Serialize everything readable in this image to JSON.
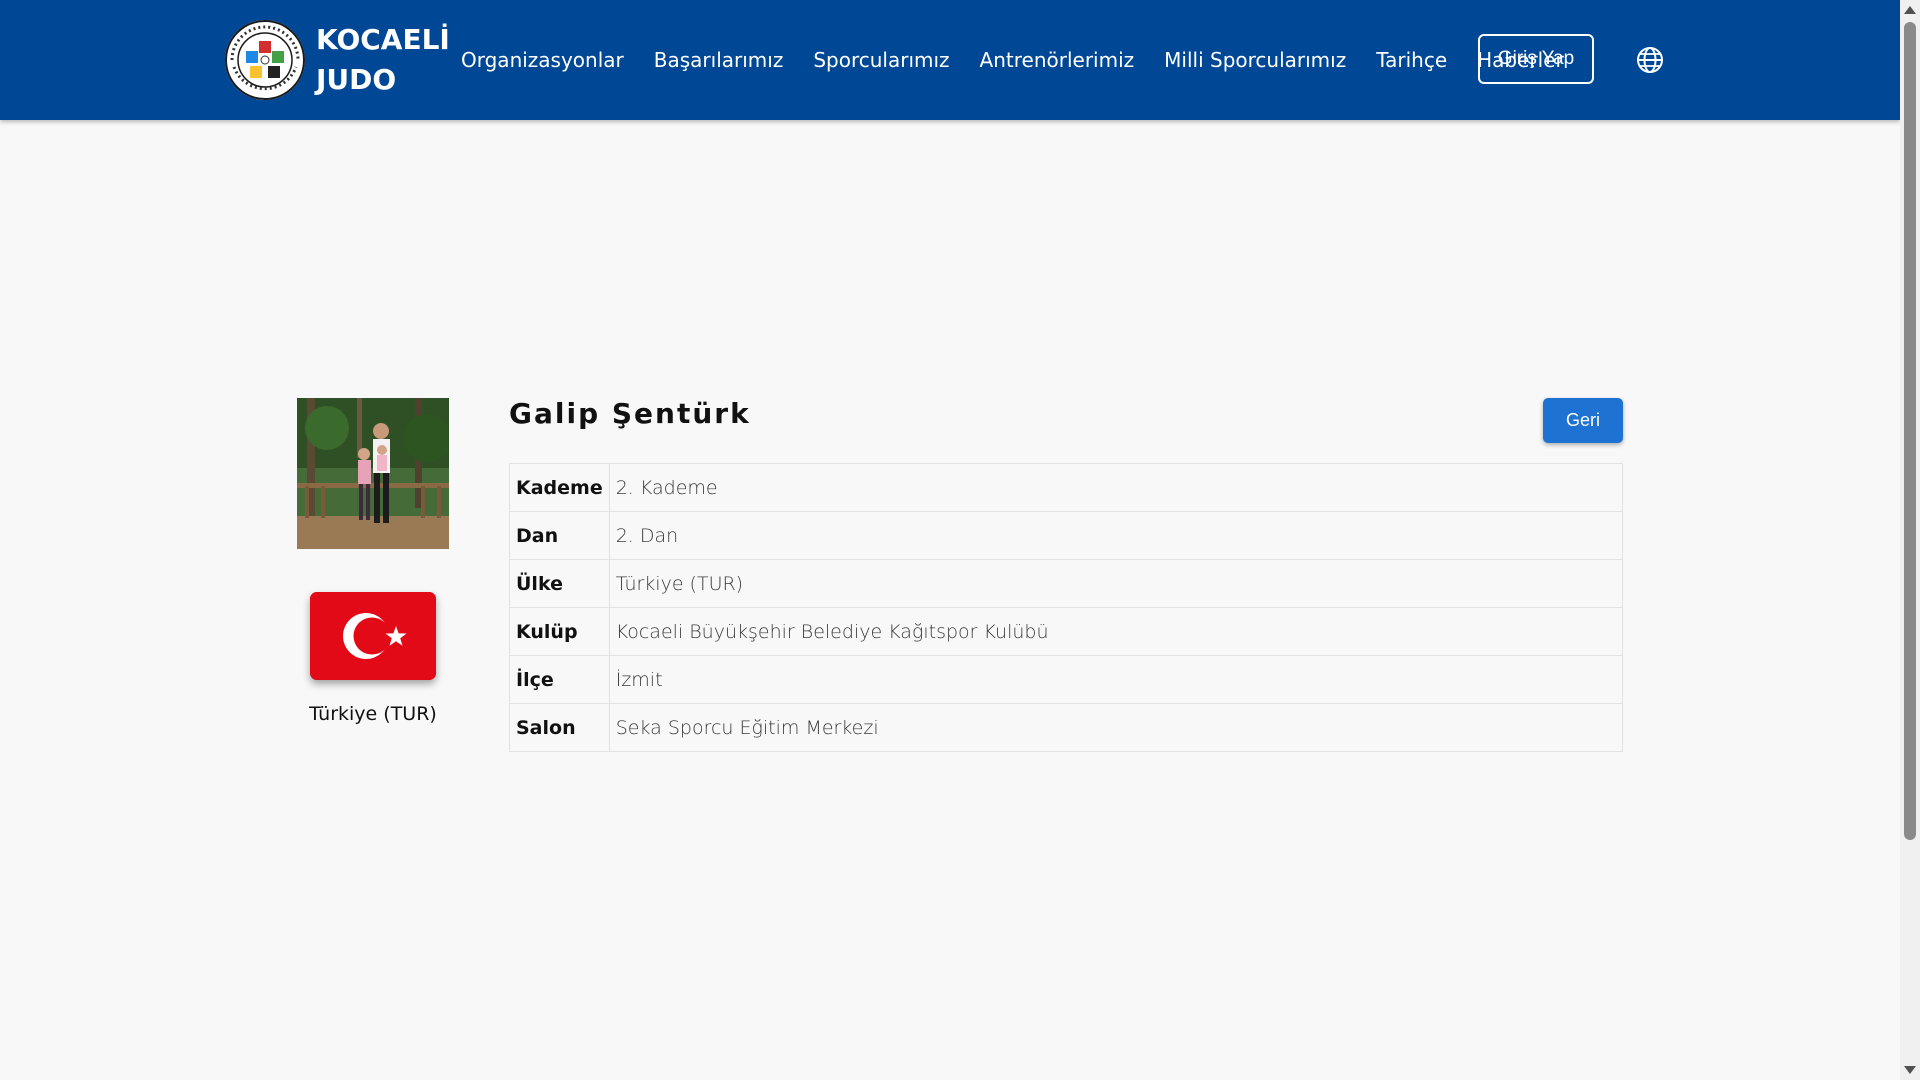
{
  "brand": {
    "line1": "KOCAELİ",
    "line2": "JUDO",
    "logo_icon": "ijf-logo-icon"
  },
  "nav": {
    "links": [
      {
        "label": "Organizasyonlar"
      },
      {
        "label": "Başarılarımız"
      },
      {
        "label": "Sporcularımız"
      },
      {
        "label": "Antrenörlerimiz"
      },
      {
        "label": "Milli Sporcularımız"
      },
      {
        "label": "Tarihçe"
      },
      {
        "label": "Haberler"
      }
    ],
    "login_label": "Giriş Yap",
    "language_icon": "globe-icon"
  },
  "athlete": {
    "name": "Galip Şentürk",
    "country_caption": "Türkiye (TUR)",
    "back_label": "Geri",
    "details": [
      {
        "key": "Kademe",
        "value": "2. Kademe"
      },
      {
        "key": "Dan",
        "value": "2. Dan"
      },
      {
        "key": "Ülke",
        "value": "Türkiye (TUR)"
      },
      {
        "key": "Kulüp",
        "value": "Kocaeli Büyükşehir Belediye Kağıtspor Kulübü"
      },
      {
        "key": "İlçe",
        "value": "İzmit"
      },
      {
        "key": "Salon",
        "value": "Seka Sporcu Eğitim Merkezi"
      }
    ]
  },
  "colors": {
    "navbar": "#004896",
    "accent_button": "#1d72d2",
    "flag_red": "#e30a17",
    "page_background": "#f8f8f8"
  }
}
